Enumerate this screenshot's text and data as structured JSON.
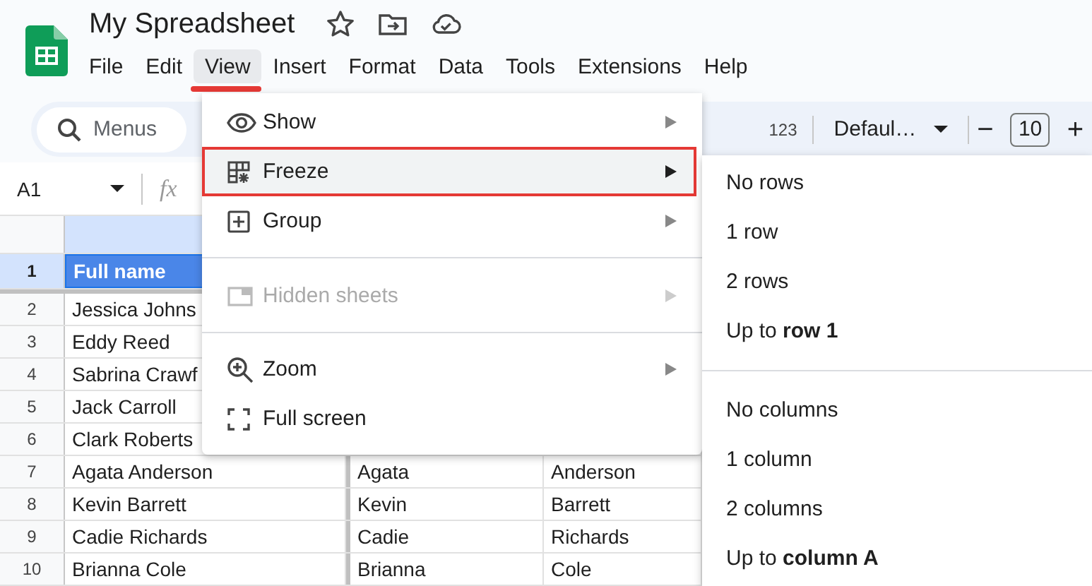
{
  "document": {
    "title": "My Spreadsheet"
  },
  "menu_bar": [
    {
      "label": "File",
      "selected": false
    },
    {
      "label": "Edit",
      "selected": false
    },
    {
      "label": "View",
      "selected": true
    },
    {
      "label": "Insert",
      "selected": false
    },
    {
      "label": "Format",
      "selected": false
    },
    {
      "label": "Data",
      "selected": false
    },
    {
      "label": "Tools",
      "selected": false
    },
    {
      "label": "Extensions",
      "selected": false
    },
    {
      "label": "Help",
      "selected": false
    }
  ],
  "toolbar": {
    "search": {
      "placeholder": "Menus"
    },
    "number_format": "123",
    "font": "Defaul…",
    "font_size_decrease": "−",
    "font_size": "10",
    "font_size_increase": "+"
  },
  "formula_bar": {
    "name_box": "A1",
    "function_label": "fx"
  },
  "sheet": {
    "rows": [
      {
        "number": "1",
        "selected": true,
        "cells": [
          "Full name"
        ]
      },
      {
        "number": "2",
        "selected": false,
        "cells": [
          "Jessica Johns"
        ]
      },
      {
        "number": "3",
        "selected": false,
        "cells": [
          "Eddy Reed"
        ]
      },
      {
        "number": "4",
        "selected": false,
        "cells": [
          "Sabrina Crawf"
        ]
      },
      {
        "number": "5",
        "selected": false,
        "cells": [
          "Jack Carroll"
        ]
      },
      {
        "number": "6",
        "selected": false,
        "cells": [
          "Clark Roberts"
        ]
      },
      {
        "number": "7",
        "selected": false,
        "cells": [
          "Agata Anderson",
          "Agata",
          "Anderson"
        ]
      },
      {
        "number": "8",
        "selected": false,
        "cells": [
          "Kevin Barrett",
          "Kevin",
          "Barrett"
        ]
      },
      {
        "number": "9",
        "selected": false,
        "cells": [
          "Cadie Richards",
          "Cadie",
          "Richards"
        ]
      },
      {
        "number": "10",
        "selected": false,
        "cells": [
          "Brianna Cole",
          "Brianna",
          "Cole"
        ]
      }
    ]
  },
  "view_menu": {
    "items": [
      {
        "kind": "item",
        "label": "Show",
        "submenu": true,
        "highlighted": false,
        "disabled": false
      },
      {
        "kind": "item",
        "label": "Freeze",
        "submenu": true,
        "highlighted": true,
        "disabled": false
      },
      {
        "kind": "item",
        "label": "Group",
        "submenu": true,
        "highlighted": false,
        "disabled": false
      },
      {
        "kind": "separator"
      },
      {
        "kind": "item",
        "label": "Hidden sheets",
        "submenu": true,
        "highlighted": false,
        "disabled": true
      },
      {
        "kind": "separator"
      },
      {
        "kind": "item",
        "label": "Zoom",
        "submenu": true,
        "highlighted": false,
        "disabled": false
      },
      {
        "kind": "item",
        "label": "Full screen",
        "submenu": false,
        "highlighted": false,
        "disabled": false
      }
    ]
  },
  "freeze_submenu": {
    "items": [
      {
        "kind": "item",
        "label": "No rows"
      },
      {
        "kind": "item",
        "label": "1 row"
      },
      {
        "kind": "item",
        "label": "2 rows"
      },
      {
        "kind": "item",
        "label": "Up to **row 1**"
      },
      {
        "kind": "separator"
      },
      {
        "kind": "item",
        "label": "No columns"
      },
      {
        "kind": "item",
        "label": "1 column"
      },
      {
        "kind": "item",
        "label": "2 columns"
      },
      {
        "kind": "item",
        "label": "Up to **column A**"
      }
    ]
  }
}
